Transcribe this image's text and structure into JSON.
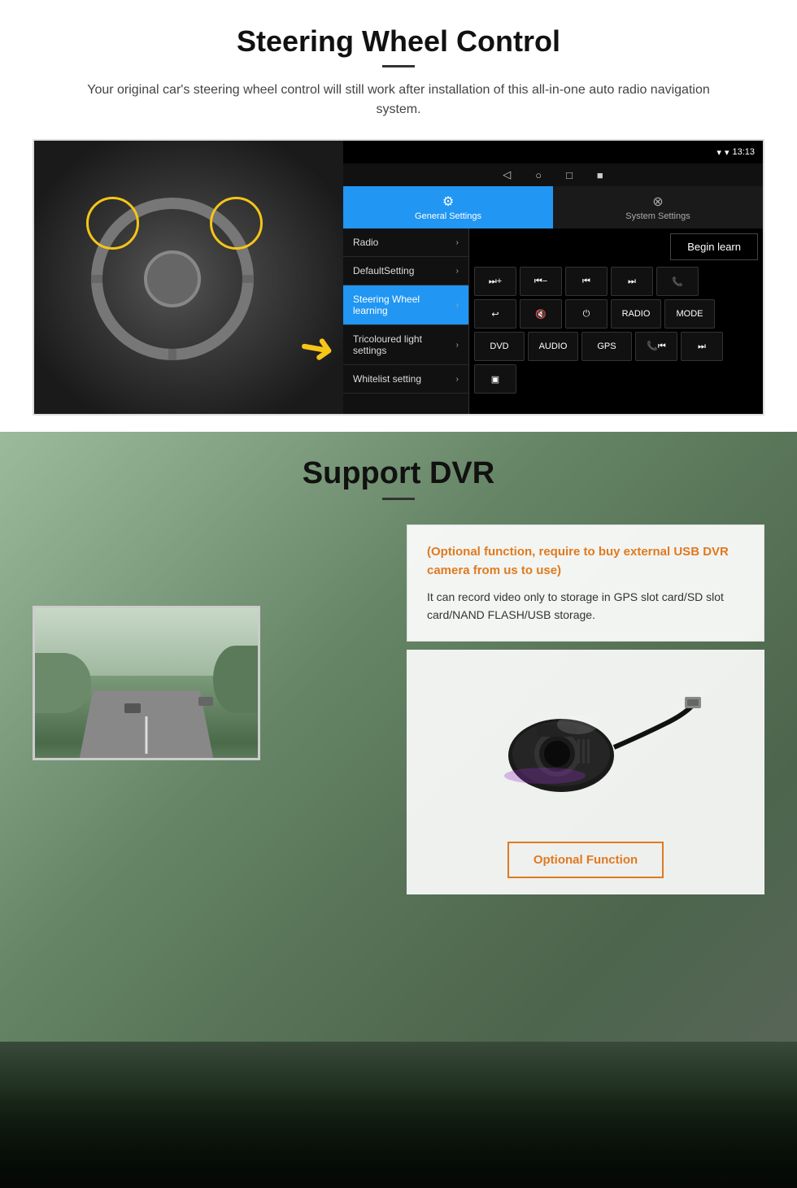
{
  "steering": {
    "title": "Steering Wheel Control",
    "subtitle": "Your original car's steering wheel control will still work after installation of this all-in-one auto radio navigation system.",
    "statusbar": {
      "time": "13:13",
      "icons": "▼ ♦ ◆"
    },
    "nav_buttons": [
      "◁",
      "○",
      "□",
      "■"
    ],
    "tabs": [
      {
        "icon": "⚙",
        "label": "General Settings",
        "active": true
      },
      {
        "icon": "⊗",
        "label": "System Settings",
        "active": false
      }
    ],
    "menu_items": [
      {
        "label": "Radio",
        "active": false
      },
      {
        "label": "DefaultSetting",
        "active": false
      },
      {
        "label": "Steering Wheel learning",
        "active": true
      },
      {
        "label": "Tricoloured light settings",
        "active": false
      },
      {
        "label": "Whitelist setting",
        "active": false
      }
    ],
    "begin_learn_label": "Begin learn",
    "control_buttons": [
      [
        "⏮+",
        "⏮−",
        "⏮⏮",
        "⏭⏭",
        "☎"
      ],
      [
        "↩",
        "⏐×",
        "⏻",
        "RADIO",
        "MODE"
      ],
      [
        "DVD",
        "AUDIO",
        "GPS",
        "☎⏮",
        "⏭⏭"
      ],
      [
        "⊟"
      ]
    ]
  },
  "dvr": {
    "title": "Support DVR",
    "optional_text": "(Optional function, require to buy external USB DVR camera from us to use)",
    "description": "It can record video only to storage in GPS slot card/SD slot card/NAND FLASH/USB storage.",
    "optional_function_label": "Optional Function"
  }
}
